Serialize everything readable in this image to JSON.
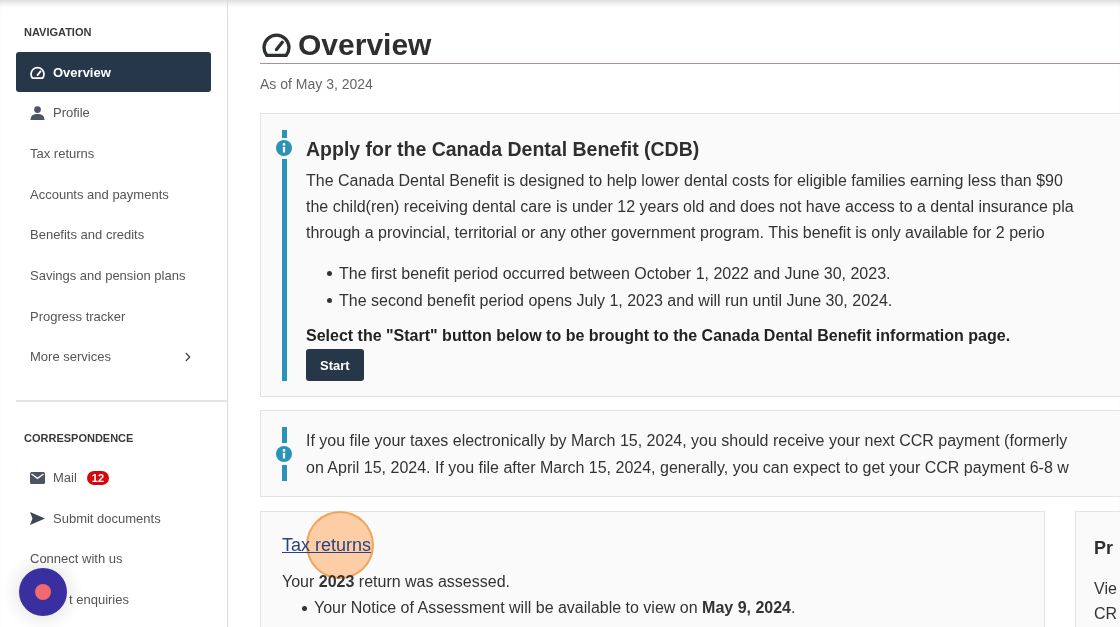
{
  "sidebar": {
    "sections": [
      {
        "heading": "NAVIGATION",
        "items": [
          {
            "label": "Overview",
            "kind": "gauge",
            "selected": true
          },
          {
            "label": "Profile",
            "kind": "person",
            "selected": false
          },
          {
            "label": "Tax returns",
            "kind": "text",
            "selected": false
          },
          {
            "label": "Accounts and payments",
            "kind": "text",
            "selected": false
          },
          {
            "label": "Benefits and credits",
            "kind": "text",
            "selected": false
          },
          {
            "label": "Savings and pension plans",
            "kind": "text",
            "selected": false
          },
          {
            "label": "Progress tracker",
            "kind": "text",
            "selected": false
          },
          {
            "label": "More services",
            "kind": "submenu",
            "selected": false
          }
        ]
      },
      {
        "heading": "CORRESPONDENCE",
        "items": [
          {
            "label": "Mail",
            "kind": "envelope",
            "selected": false,
            "badge": "12"
          },
          {
            "label": "Submit documents",
            "kind": "send",
            "selected": false
          },
          {
            "label": "Connect with us",
            "kind": "text",
            "selected": false
          },
          {
            "label": "t enquiries",
            "kind": "covered",
            "selected": false
          }
        ]
      }
    ]
  },
  "page": {
    "title": "Overview",
    "as_of": "As of May 3, 2024"
  },
  "notices": [
    {
      "title": "Apply for the Canada Dental Benefit (CDB)",
      "lines": [
        "The Canada Dental Benefit is designed to help lower dental costs for eligible families earning less than $90",
        "the child(ren) receiving dental care is under 12 years old and does not have access to a dental insurance pla",
        "through a provincial, territorial or any other government program. This benefit is only available for 2 perio"
      ],
      "bullets": [
        "The first benefit period occurred between October 1, 2022 and June 30, 2023.",
        "The second benefit period opens July 1, 2023 and will run until June 30, 2024."
      ],
      "instruction": "Select the \"Start\" button below to be brought to the Canada Dental Benefit information page.",
      "button": "Start"
    },
    {
      "lines": [
        "If you file your taxes electronically by March 15, 2024, you should receive your next CCR payment (formerly",
        "on April 15, 2024. If you file after March 15, 2024, generally, you can expect to get your CCR payment 6-8 w"
      ]
    }
  ],
  "cards": [
    {
      "kind": "link",
      "title": "Tax returns",
      "text": "Your **2023** return was assessed.",
      "bullets": [
        "Your Notice of Assessment will be available to view on **May 9, 2024**."
      ]
    },
    {
      "kind": "heading",
      "title": "Pr",
      "lines": [
        "Vie",
        "CR"
      ]
    }
  ]
}
